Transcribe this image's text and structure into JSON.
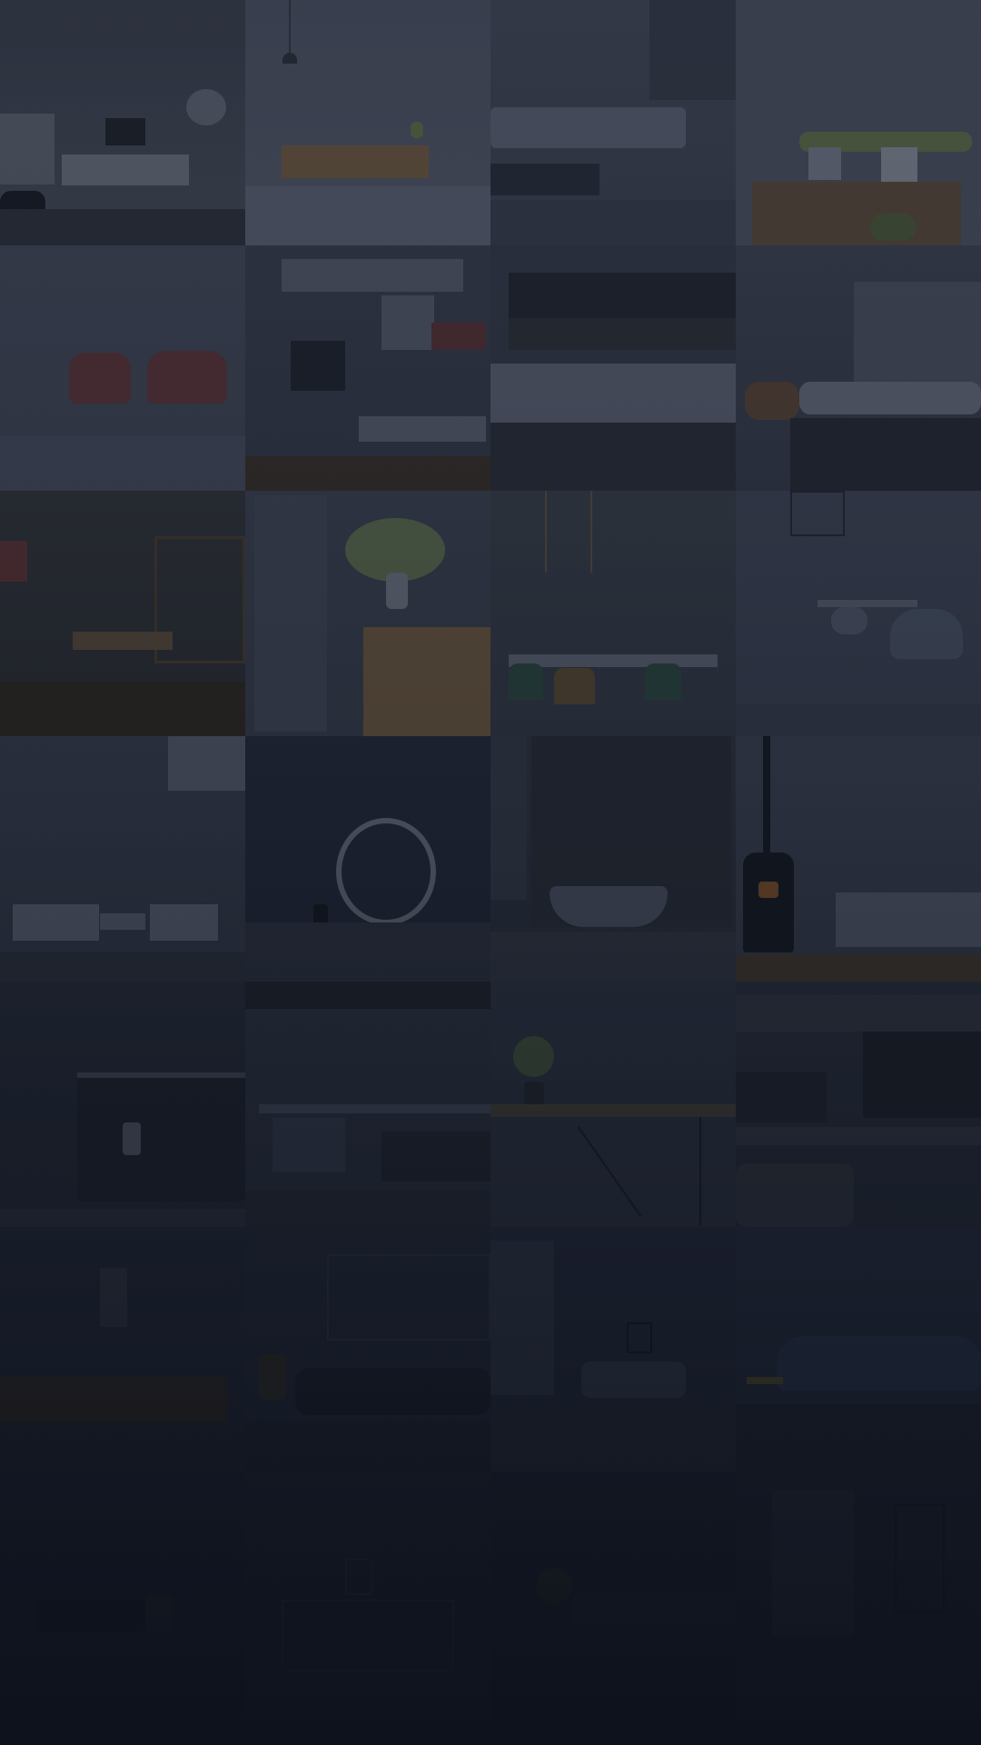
{
  "background": {
    "overlay_color": "#151b27",
    "tiles": [
      {
        "name": "tile-living-room-tv",
        "base": "#2d3340"
      },
      {
        "name": "tile-sideboard",
        "base": "#3a4050"
      },
      {
        "name": "tile-sofa-staircase",
        "base": "#343a48"
      },
      {
        "name": "tile-plants-wall",
        "base": "#3b4150"
      },
      {
        "name": "tile-red-armchairs",
        "base": "#363c4b"
      },
      {
        "name": "tile-wall-shelving",
        "base": "#2c3240"
      },
      {
        "name": "tile-kitchen-counter",
        "base": "#2a303d"
      },
      {
        "name": "tile-lounge-rug",
        "base": "#2e3442"
      },
      {
        "name": "tile-dining-shelves",
        "base": "#262a33"
      },
      {
        "name": "tile-tulip-vase",
        "base": "#2f3542"
      },
      {
        "name": "tile-dining-chairs",
        "base": "#2b3140"
      },
      {
        "name": "tile-eames-chairs",
        "base": "#323848"
      },
      {
        "name": "tile-white-room",
        "base": "#2c3240"
      },
      {
        "name": "tile-round-mirror",
        "base": "#1d2331"
      },
      {
        "name": "tile-bathtub",
        "base": "#252b38"
      },
      {
        "name": "tile-wood-stove",
        "base": "#2f3544"
      },
      {
        "name": "tile-kitchen-shelf",
        "base": "#1f2430"
      },
      {
        "name": "tile-bar-stools",
        "base": "#252b38"
      },
      {
        "name": "tile-potted-plant-table",
        "base": "#262c39"
      },
      {
        "name": "tile-tv-wall",
        "base": "#222733"
      },
      {
        "name": "tile-kitchen-hood",
        "base": "#1d2230"
      },
      {
        "name": "tile-dark-sofa",
        "base": "#1e2331"
      },
      {
        "name": "tile-window-lounge",
        "base": "#1f2432"
      },
      {
        "name": "tile-blue-sofa",
        "base": "#212736"
      },
      {
        "name": "tile-dark-living",
        "base": "#181d2a"
      },
      {
        "name": "tile-dark-shelving",
        "base": "#191e2a"
      },
      {
        "name": "tile-dark-plant",
        "base": "#181d29"
      },
      {
        "name": "tile-dark-doorway",
        "base": "#1a1f2c"
      }
    ]
  }
}
